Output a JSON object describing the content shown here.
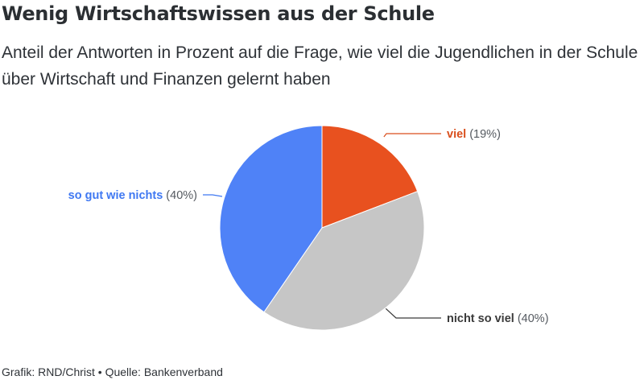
{
  "title": "Wenig Wirtschaftswissen aus der Schule",
  "subtitle": "Anteil der Antworten in Prozent auf die Frage, wie viel die Jugendlichen in der Schule über Wirtschaft und Finanzen gelernt haben",
  "footer": "Grafik: RND/Christ • Quelle: Bankenverband",
  "chart_data": {
    "type": "pie",
    "title": "Wenig Wirtschaftswissen aus der Schule",
    "slices": [
      {
        "name": "viel",
        "value": 19,
        "value_label": "(19%)",
        "color": "#e8511f"
      },
      {
        "name": "nicht so viel",
        "value": 40,
        "value_label": "(40%)",
        "color": "#c6c6c6"
      },
      {
        "name": "so gut wie nichts",
        "value": 40,
        "value_label": "(40%)",
        "color": "#4f82f7"
      }
    ],
    "label_colors": {
      "viel": "#d94e1c",
      "nicht so viel": "#3a3a3a",
      "so gut wie nichts": "#3f78f2"
    },
    "value_color": "#555a60"
  }
}
